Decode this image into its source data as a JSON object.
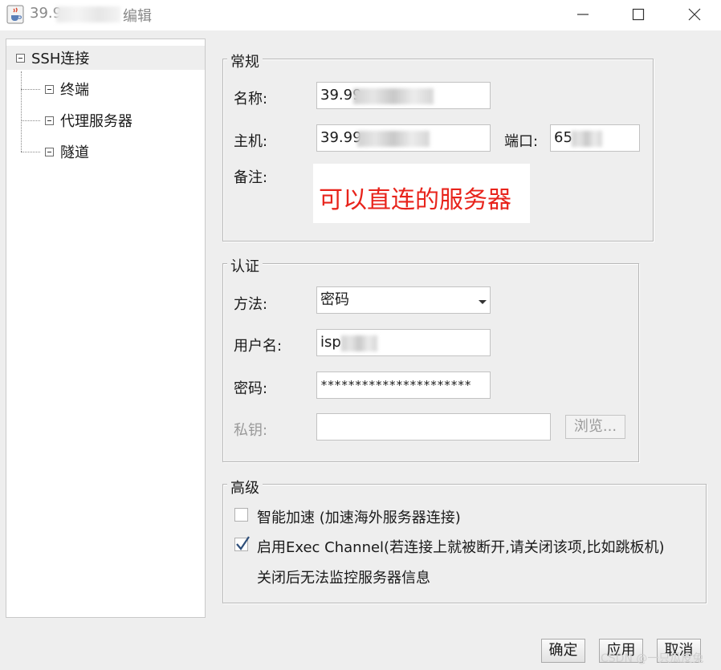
{
  "window": {
    "title_prefix": "39.9",
    "title_suffix": "编辑",
    "icon": "java-cup-icon"
  },
  "tree": {
    "root": "SSH连接",
    "children": [
      "终端",
      "代理服务器",
      "隧道"
    ]
  },
  "general": {
    "legend": "常规",
    "name_label": "名称:",
    "name_value": "39.99",
    "host_label": "主机:",
    "host_value": "39.99",
    "port_label": "端口:",
    "port_value": "65",
    "note_label": "备注:",
    "note_text": "可以直连的服务器"
  },
  "auth": {
    "legend": "认证",
    "method_label": "方法:",
    "method_value": "密码",
    "username_label": "用户名:",
    "username_value": "isp",
    "password_label": "密码:",
    "password_value": "**********************",
    "private_key_label": "私钥:",
    "private_key_value": "",
    "browse_label": "浏览..."
  },
  "advanced": {
    "legend": "高级",
    "smart_accel_label": "智能加速 (加速海外服务器连接)",
    "smart_accel_checked": false,
    "exec_channel_label": "启用Exec Channel(若连接上就被断开,请关闭该项,比如跳板机)",
    "exec_channel_checked": true,
    "exec_channel_note": "关闭后无法监控服务器信息"
  },
  "footer": {
    "ok_label": "确定",
    "apply_label": "应用",
    "cancel_label": "取消"
  },
  "watermark": "CSDN @一只瓜皮兔"
}
